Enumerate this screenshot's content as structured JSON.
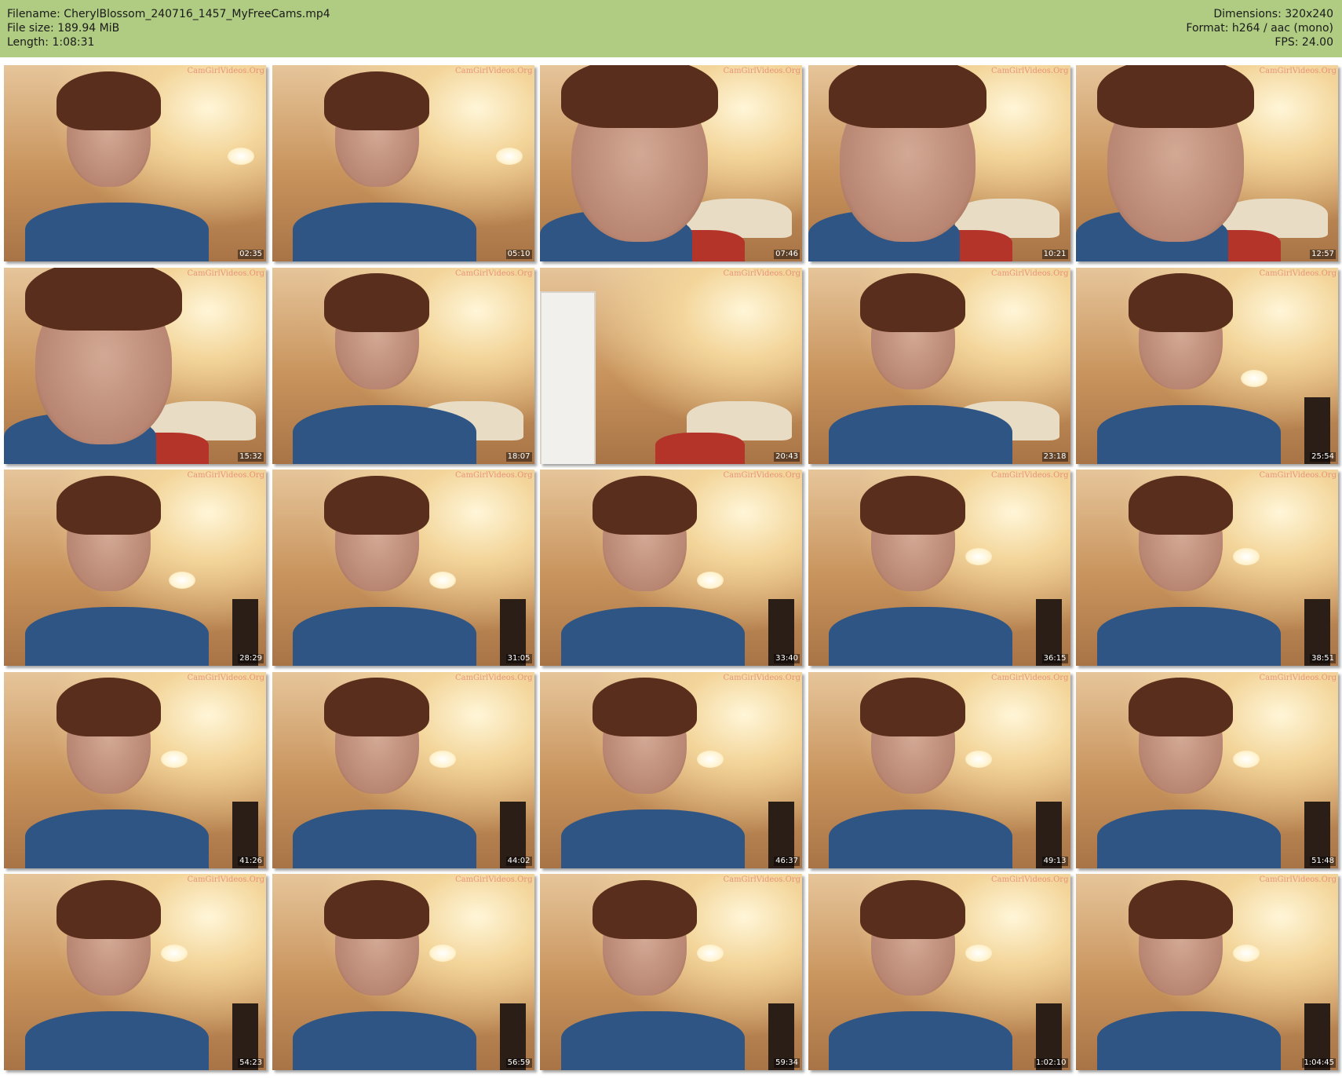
{
  "header": {
    "filename_label": "Filename: CherylBlossom_240716_1457_MyFreeCams.mp4",
    "filesize_label": "File size: 189.94 MiB",
    "length_label": "Length: 1:08:31",
    "dimensions_label": "Dimensions: 320x240",
    "format_label": "Format: h264 / aac (mono)",
    "fps_label": "FPS: 24.00",
    "background_color": "#b0cc82"
  },
  "watermark": "CamGirlVideos.Org",
  "thumbnails": [
    {
      "timestamp": "02:35"
    },
    {
      "timestamp": "05:10"
    },
    {
      "timestamp": "07:46"
    },
    {
      "timestamp": "10:21"
    },
    {
      "timestamp": "12:57"
    },
    {
      "timestamp": "15:32"
    },
    {
      "timestamp": "18:07"
    },
    {
      "timestamp": "20:43"
    },
    {
      "timestamp": "23:18"
    },
    {
      "timestamp": "25:54"
    },
    {
      "timestamp": "28:29"
    },
    {
      "timestamp": "31:05"
    },
    {
      "timestamp": "33:40"
    },
    {
      "timestamp": "36:15"
    },
    {
      "timestamp": "38:51"
    },
    {
      "timestamp": "41:26"
    },
    {
      "timestamp": "44:02"
    },
    {
      "timestamp": "46:37"
    },
    {
      "timestamp": "49:13"
    },
    {
      "timestamp": "51:48"
    },
    {
      "timestamp": "54:23"
    },
    {
      "timestamp": "56:59"
    },
    {
      "timestamp": "59:34"
    },
    {
      "timestamp": "1:02:10"
    },
    {
      "timestamp": "1:04:45"
    }
  ]
}
